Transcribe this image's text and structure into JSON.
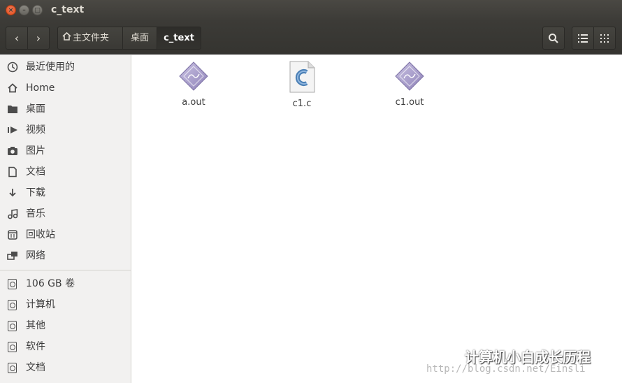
{
  "window": {
    "title": "c_text"
  },
  "toolbar": {
    "nav_back": "‹",
    "nav_forward": "›",
    "breadcrumbs": [
      "主文件夹",
      "桌面",
      "c_text"
    ]
  },
  "sidebar": {
    "places": [
      {
        "label": "最近使用的",
        "icon": "recent-clock-icon"
      },
      {
        "label": "Home",
        "icon": "home-icon"
      },
      {
        "label": "桌面",
        "icon": "folder-icon"
      },
      {
        "label": "视频",
        "icon": "video-icon"
      },
      {
        "label": "图片",
        "icon": "camera-icon"
      },
      {
        "label": "文档",
        "icon": "document-icon"
      },
      {
        "label": "下载",
        "icon": "download-icon"
      },
      {
        "label": "音乐",
        "icon": "music-icon"
      },
      {
        "label": "回收站",
        "icon": "trash-icon"
      },
      {
        "label": "网络",
        "icon": "network-icon"
      }
    ],
    "devices": [
      {
        "label": "106 GB 卷",
        "icon": "drive-icon"
      },
      {
        "label": "计算机",
        "icon": "drive-icon"
      },
      {
        "label": "其他",
        "icon": "drive-icon"
      },
      {
        "label": "软件",
        "icon": "drive-icon"
      },
      {
        "label": "文档",
        "icon": "drive-icon"
      }
    ]
  },
  "files": [
    {
      "name": "a.out",
      "icon": "executable-icon"
    },
    {
      "name": "c1.c",
      "icon": "c-source-icon"
    },
    {
      "name": "c1.out",
      "icon": "executable-icon"
    }
  ],
  "watermark": {
    "title": "计算机小白成长历程",
    "url": "http://blog.csdn.net/Einsli"
  },
  "colors": {
    "titlebar": "#3c3b37",
    "close_button": "#df4a16",
    "sidebar_bg": "#f2f1f0",
    "executable_icon": "#9b8fc0",
    "c_icon": "#4a7fb5"
  }
}
